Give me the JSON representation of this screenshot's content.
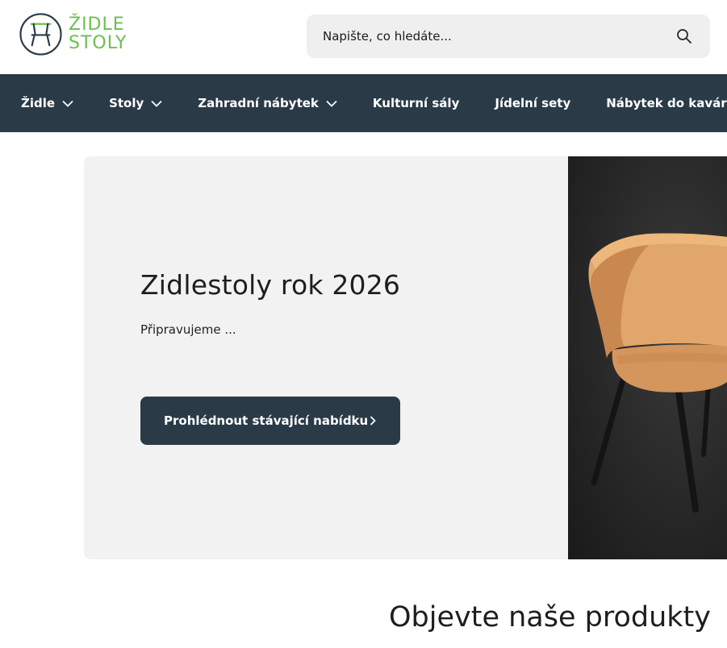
{
  "brand": {
    "logo_line1": "ŽIDLE",
    "logo_line2": "STOLY",
    "logo_color": "#6cbf4f",
    "mark_color": "#2a3a47"
  },
  "search": {
    "placeholder": "Napište, co hledáte...",
    "icon": "search-icon"
  },
  "nav": {
    "items": [
      {
        "label": "Židle",
        "has_dropdown": true
      },
      {
        "label": "Stoly",
        "has_dropdown": true
      },
      {
        "label": "Zahradní nábytek",
        "has_dropdown": true
      },
      {
        "label": "Kulturní sály",
        "has_dropdown": false
      },
      {
        "label": "Jídelní sety",
        "has_dropdown": false
      },
      {
        "label": "Nábytek do kavárny a restaurace",
        "has_dropdown": false
      }
    ],
    "background": "#2a3a47"
  },
  "hero": {
    "title": "Zidlestoly rok 2026",
    "subtitle": "Připravujeme ...",
    "button_label": "Prohlédnout stávající nabídku",
    "image_alt": "Upholstered armchair with black legs",
    "chair_color": "#d9a36a"
  },
  "products_section": {
    "title": "Objevte naše produkty"
  }
}
